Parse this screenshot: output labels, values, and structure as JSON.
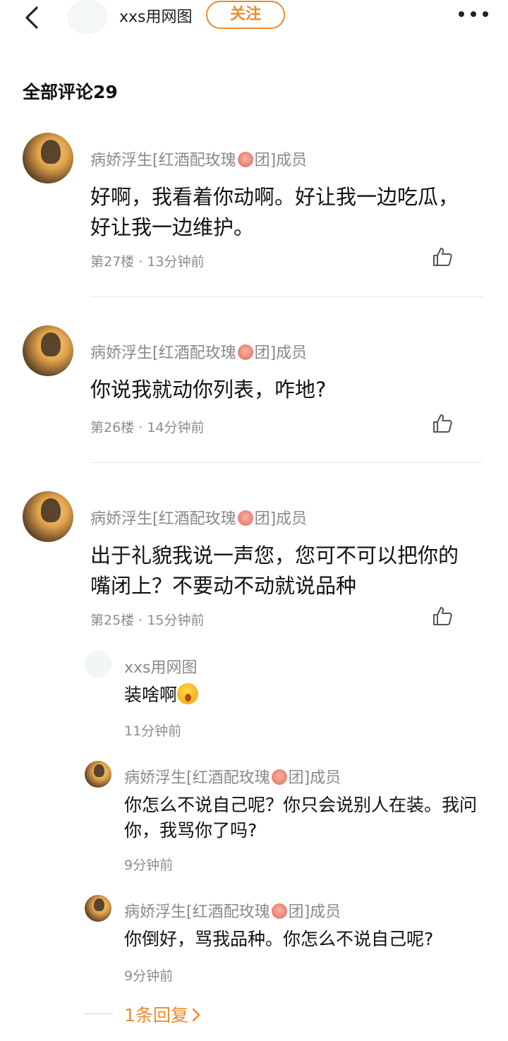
{
  "header": {
    "author_name": "xxs用网图",
    "follow_label": "关注"
  },
  "comments_title": "全部评论29",
  "comments": [
    {
      "user": "病娇浮生[红酒配玫瑰",
      "user_suffix": "团]成员",
      "content": "好啊，我看着你动啊。好让我一边吃瓜，好让我一边维护。",
      "floor": "第27楼",
      "time": "13分钟前"
    },
    {
      "user": "病娇浮生[红酒配玫瑰",
      "user_suffix": "团]成员",
      "content": "你说我就动你列表，咋地?",
      "floor": "第26楼",
      "time": "14分钟前"
    },
    {
      "user": "病娇浮生[红酒配玫瑰",
      "user_suffix": "团]成员",
      "content": "出于礼貌我说一声您，您可不可以把你的嘴闭上？不要动不动就说品种",
      "floor": "第25楼",
      "time": "15分钟前"
    }
  ],
  "meta_separator": "·",
  "replies": [
    {
      "user": "xxs用网图",
      "content": "装啥啊",
      "emoji": "astonished-face-icon",
      "time": "11分钟前"
    },
    {
      "user": "病娇浮生[红酒配玫瑰",
      "user_suffix": "团]成员",
      "content": "你怎么不说自己呢？你只会说别人在装。我问你，我骂你了吗?",
      "time": "9分钟前"
    },
    {
      "user": "病娇浮生[红酒配玫瑰",
      "user_suffix": "团]成员",
      "content": "你倒好，骂我品种。你怎么不说自己呢?",
      "time": "9分钟前"
    }
  ],
  "more_replies": "1条回复",
  "colors": {
    "accent": "#f08a2a",
    "meta": "#8c8c8c",
    "divider": "#e8e8e8"
  }
}
